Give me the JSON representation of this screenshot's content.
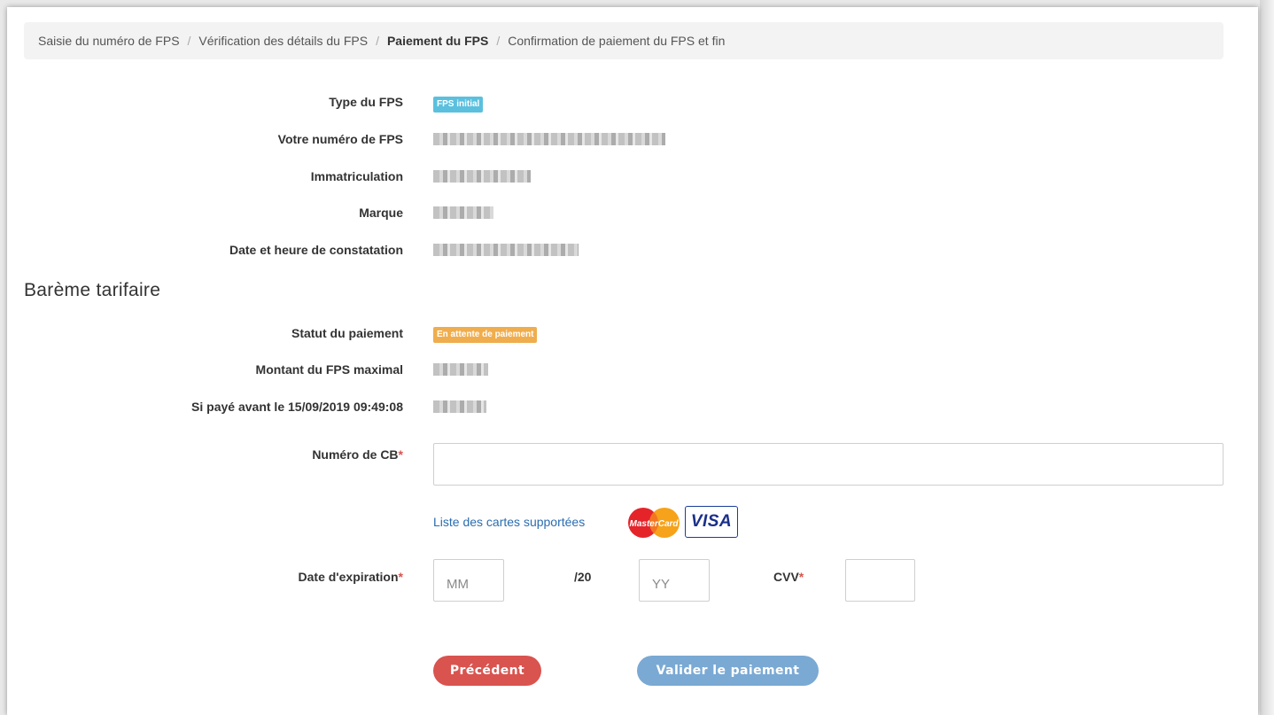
{
  "breadcrumb": {
    "step1": "Saisie du numéro de FPS",
    "step2": "Vérification des détails du FPS",
    "step3": "Paiement du FPS",
    "step4": "Confirmation de paiement du FPS et fin",
    "separator": "/"
  },
  "details": {
    "type_label": "Type du FPS",
    "type_badge": "FPS initial",
    "number_label": "Votre numéro de FPS",
    "plate_label": "Immatriculation",
    "brand_label": "Marque",
    "date_label": "Date et heure de constatation"
  },
  "tariff": {
    "section_title": "Barème tarifaire",
    "status_label": "Statut du paiement",
    "status_badge": "En attente de paiement",
    "max_amount_label": "Montant du FPS maximal",
    "reduced_label": "Si payé avant le 15/09/2019 09:49:08"
  },
  "payment_form": {
    "card_number_label": "Numéro de CB",
    "card_number_value": "",
    "supported_cards_link": "Liste des cartes supportées",
    "card_logos": [
      "MasterCard",
      "VISA"
    ],
    "expiry_label": "Date d'expiration",
    "month_placeholder": "MM",
    "year_prefix": "/20",
    "year_placeholder": "YY",
    "cvv_label": "CVV",
    "cvv_value": "",
    "required_marker": "*"
  },
  "actions": {
    "previous": "Précédent",
    "submit": "Valider le paiement"
  },
  "colors": {
    "info_badge": "#5bc0de",
    "warning_badge": "#f0ad4e",
    "previous_button": "#d9534f",
    "submit_button": "#7aa9d4",
    "link": "#2a6db0"
  }
}
